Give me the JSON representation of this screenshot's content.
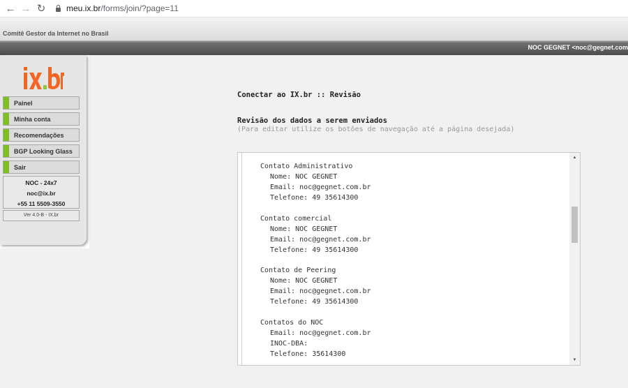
{
  "browser": {
    "url_domain": "meu.ix.br",
    "url_path": "/forms/join/?page=11"
  },
  "header": {
    "org_name": "Comitê Gestor da Internet no Brasil",
    "user": "NOC GEGNET <noc@gegnet.com"
  },
  "sidebar": {
    "logo_text": "ix.br",
    "items": [
      {
        "label": "Painel"
      },
      {
        "label": "Minha conta"
      },
      {
        "label": "Recomendações"
      },
      {
        "label": "BGP Looking Glass"
      },
      {
        "label": "Sair"
      }
    ],
    "noc": {
      "title": "NOC - 24x7",
      "email": "noc@ix.br",
      "phone": "+55 11 5509-3550"
    },
    "version": "Ver 4.0-B - IX.br"
  },
  "main": {
    "title": "Conectar ao IX.br :: Revisão",
    "review_title": "Revisão dos dados a serem enviados",
    "review_hint": "(Para editar utilize os botões de navegação até a página desejada)",
    "sections": [
      {
        "heading": "Contato Administrativo",
        "fields": [
          "Nome: NOC GEGNET",
          "Email: noc@gegnet.com.br",
          "Telefone: 49 35614300"
        ]
      },
      {
        "heading": "Contato comercial",
        "fields": [
          "Nome: NOC GEGNET",
          "Email: noc@gegnet.com.br",
          "Telefone: 49 35614300"
        ]
      },
      {
        "heading": "Contato de Peering",
        "fields": [
          "Nome: NOC GEGNET",
          "Email: noc@gegnet.com.br",
          "Telefone: 49 35614300"
        ]
      },
      {
        "heading": "Contatos do NOC",
        "fields": [
          "Email: noc@gegnet.com.br",
          "INOC-DBA:",
          "Telefone: 35614300"
        ]
      }
    ]
  },
  "colors": {
    "menu_marker": "#7fbf1f",
    "logo_orange": "#f26522",
    "logo_green": "#8dc63f"
  },
  "icons": {
    "back": "arrow-left-icon",
    "forward": "arrow-right-icon",
    "reload": "reload-icon",
    "lock": "lock-icon",
    "scroll_up": "scroll-up-icon",
    "scroll_down": "scroll-down-icon"
  }
}
